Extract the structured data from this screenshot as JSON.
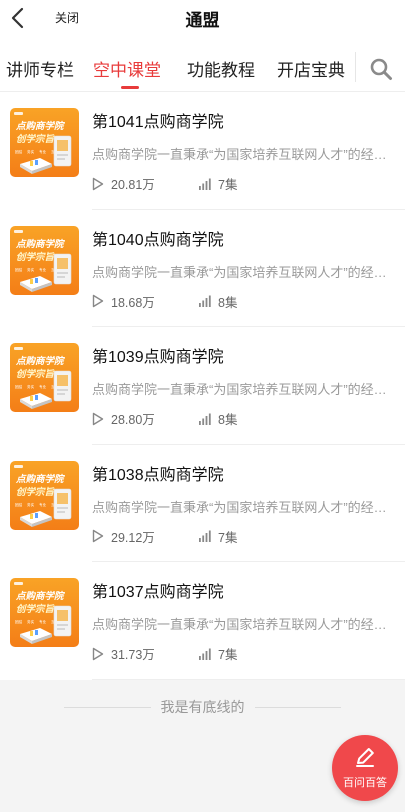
{
  "header": {
    "back_icon": "chevron-left-icon",
    "close_label": "关闭",
    "title": "通盟"
  },
  "tabs": [
    {
      "label": "讲师专栏",
      "active": false
    },
    {
      "label": "空中课堂",
      "active": true
    },
    {
      "label": "功能教程",
      "active": false
    },
    {
      "label": "开店宝典",
      "active": false
    }
  ],
  "search_icon": "search-icon",
  "accent_color": "#e83b3b",
  "courses": [
    {
      "title": "第1041点购商学院",
      "desc": "点购商学院一直秉承“为国家培养互联网人才”的经营理念",
      "plays": "20.81万",
      "episodes": "7集"
    },
    {
      "title": "第1040点购商学院",
      "desc": "点购商学院一直秉承“为国家培养互联网人才”的经营理念",
      "plays": "18.68万",
      "episodes": "8集"
    },
    {
      "title": "第1039点购商学院",
      "desc": "点购商学院一直秉承“为国家培养互联网人才”的经营理念",
      "plays": "28.80万",
      "episodes": "8集"
    },
    {
      "title": "第1038点购商学院",
      "desc": "点购商学院一直秉承“为国家培养互联网人才”的经营理念",
      "plays": "29.12万",
      "episodes": "7集"
    },
    {
      "title": "第1037点购商学院",
      "desc": "点购商学院一直秉承“为国家培养互联网人才”的经营理念",
      "plays": "31.73万",
      "episodes": "7集"
    }
  ],
  "thumbnail": {
    "line1": "点购商学院",
    "line2": "创学宗旨",
    "tags": [
      "团结",
      "务实",
      "专业",
      "互助"
    ]
  },
  "footer": {
    "end_text": "我是有底线的"
  },
  "fab": {
    "icon": "pencil-icon",
    "label": "百问百答"
  }
}
